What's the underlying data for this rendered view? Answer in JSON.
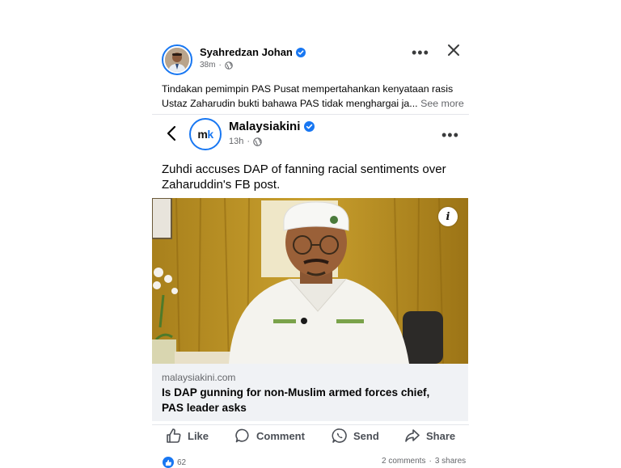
{
  "post": {
    "author": "Syahredzan Johan",
    "time": "38m",
    "privacy_icon": "globe-icon",
    "caption_line1": "Tindakan pemimpin PAS Pusat mempertahankan kenyataan rasis",
    "caption_line2": "Ustaz Zaharudin bukti bahawa PAS tidak menghargai ja...",
    "see_more": "See more",
    "more_label": "•••"
  },
  "shared": {
    "page_name": "Malaysiakini",
    "logo_text_m": "m",
    "logo_text_k": "k",
    "time": "13h",
    "more_label": "•••",
    "headline_line1": "Zuhdi accuses DAP of fanning racial sentiments over",
    "headline_line2": "Zaharuddin's FB post.",
    "info_label": "i",
    "link_domain": "malaysiakini.com",
    "link_title_line1": "Is DAP gunning for non-Muslim armed forces chief,",
    "link_title_line2": "PAS leader asks"
  },
  "actions": {
    "like": "Like",
    "comment": "Comment",
    "send": "Send",
    "share": "Share"
  },
  "stats": {
    "reactions": "62",
    "comments": "2 comments",
    "shares": "3 shares",
    "separator": "·"
  },
  "colors": {
    "accent": "#1877f2",
    "muted": "#65676b",
    "link_bg": "#f0f2f5"
  }
}
